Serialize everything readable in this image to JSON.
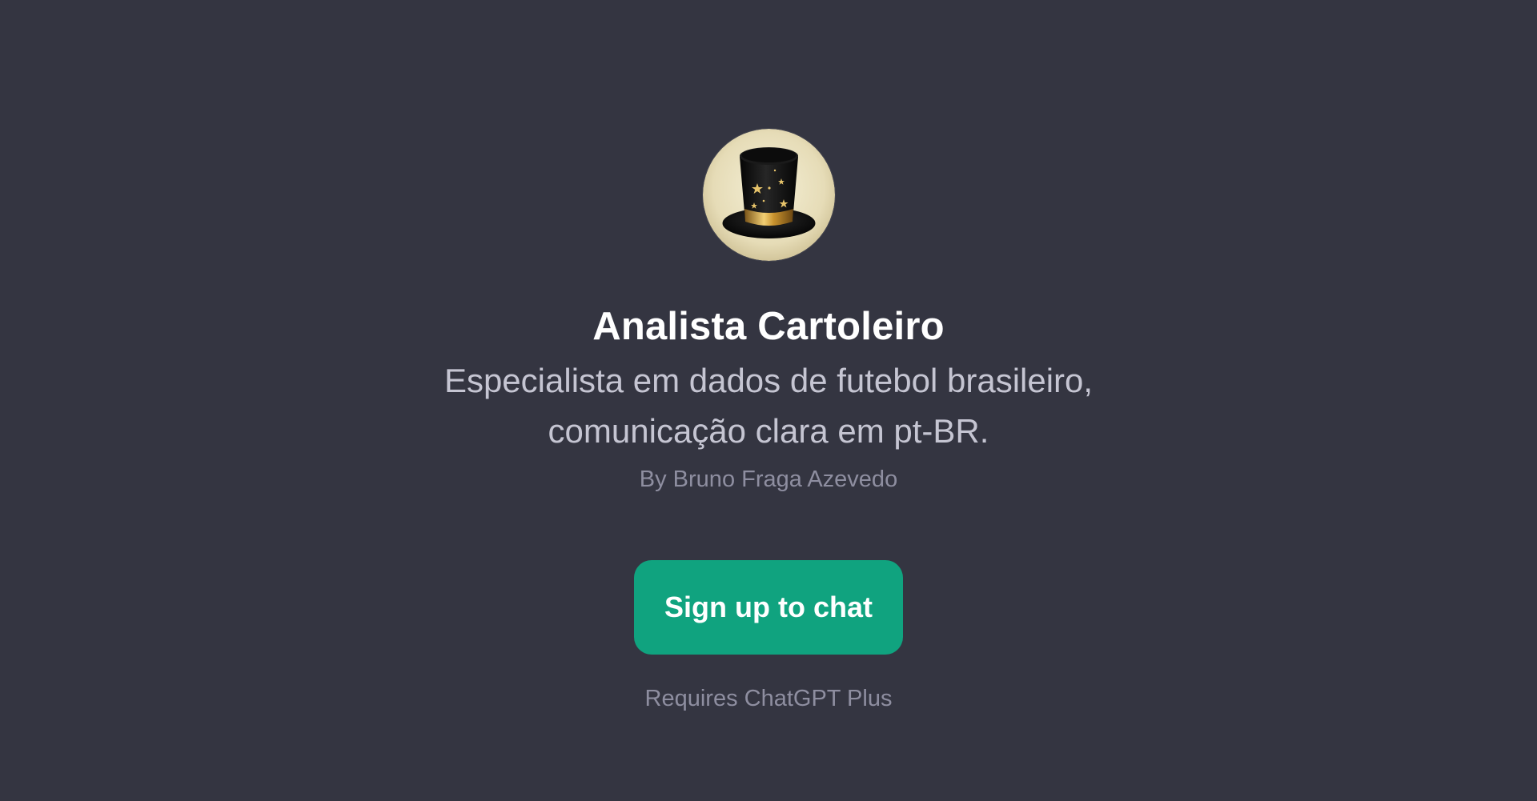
{
  "gpt": {
    "avatar_icon": "top-hat-icon",
    "name": "Analista Cartoleiro",
    "description": "Especialista em dados de futebol brasileiro, comunicação clara em pt-BR.",
    "author": "By Bruno Fraga Azevedo"
  },
  "actions": {
    "signup_label": "Sign up to chat",
    "requirement_note": "Requires ChatGPT Plus"
  },
  "colors": {
    "background": "#343541",
    "accent": "#10a37f",
    "title": "#ffffff",
    "description": "#c5c5d2",
    "muted": "#8e8ea0"
  }
}
